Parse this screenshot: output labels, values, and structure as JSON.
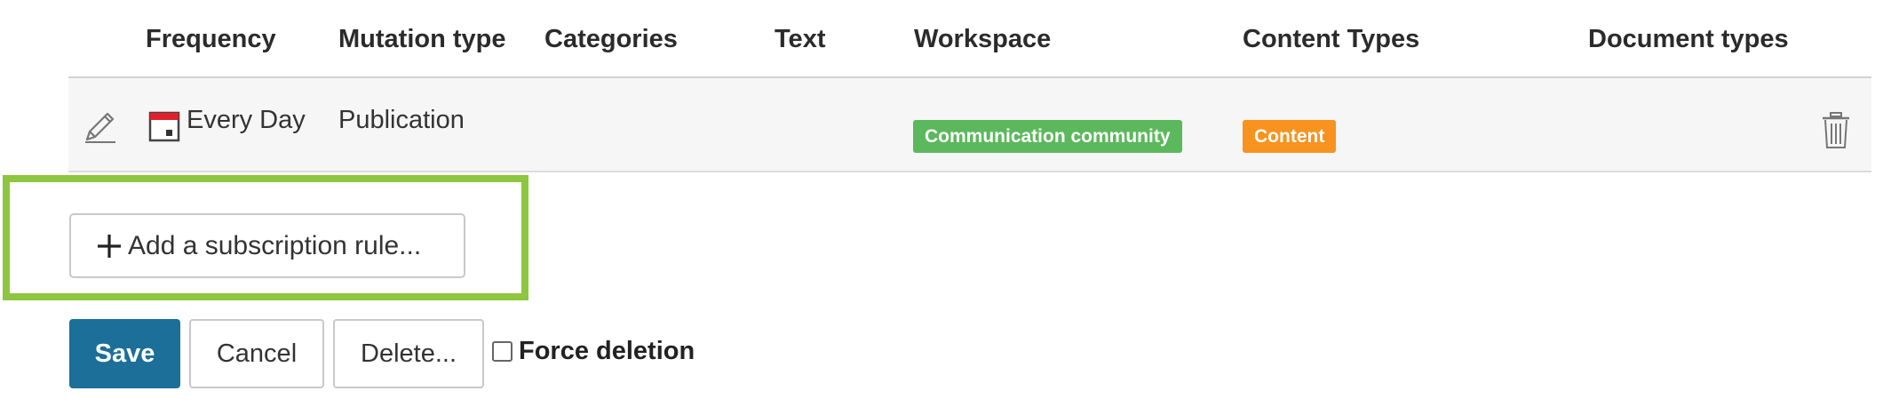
{
  "table": {
    "columns": [
      {
        "label": "Frequency"
      },
      {
        "label": "Mutation type"
      },
      {
        "label": "Categories"
      },
      {
        "label": "Text"
      },
      {
        "label": "Workspace"
      },
      {
        "label": "Content Types"
      },
      {
        "label": "Document types"
      }
    ],
    "rows": [
      {
        "frequency": "Every Day",
        "mutation_type": "Publication",
        "categories": "",
        "text": "",
        "workspace": "Communication community",
        "content_types": "Content",
        "document_types": "",
        "icons": {
          "edit": "pencil-icon",
          "frequency": "calendar-icon",
          "delete": "trash-icon"
        }
      }
    ]
  },
  "add_rule": {
    "label": "Add a subscription rule...",
    "icon": "plus-icon"
  },
  "actions": {
    "save_label": "Save",
    "cancel_label": "Cancel",
    "delete_label": "Delete...",
    "force_deletion_label": "Force deletion",
    "force_deletion_checked": false
  },
  "colors": {
    "workspace_badge": "#5cb85c",
    "content_badge": "#f7931e",
    "save_button": "#1c6f98",
    "highlight_border": "#8dc63f",
    "calendar_accent": "#e0202c"
  }
}
